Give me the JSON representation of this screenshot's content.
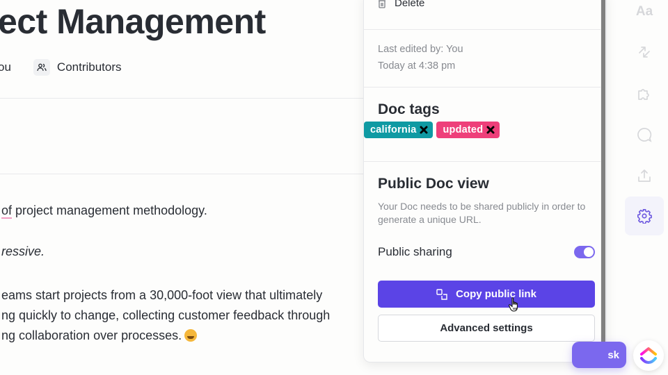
{
  "document": {
    "title": "ect Management",
    "meta": {
      "author_fragment": "ou",
      "contributors_label": "Contributors",
      "contributors_icon": "users-icon"
    },
    "paragraphs": {
      "p1_underlined": "of",
      "p1_rest": " project management methodology.",
      "p2": "ressive.",
      "p3_lines": [
        "eams start projects from a 30,000-foot view that ultimately",
        "ng quickly to change, collecting customer feedback through",
        "ng collaboration over processes."
      ],
      "p3_emoji": "star-struck-emoji"
    }
  },
  "panel": {
    "delete_label": "Delete",
    "delete_icon": "trash-icon",
    "last_edited_by": "Last edited by: You",
    "last_edited_time": "Today at 4:38 pm",
    "tags_title": "Doc tags",
    "tags": [
      {
        "label": "california",
        "color": "#0f9aa3"
      },
      {
        "label": "updated",
        "color": "#ee3f7a"
      }
    ],
    "public_title": "Public Doc view",
    "public_description": "Your Doc needs to be shared publicly in order to generate a unique URL.",
    "public_sharing_label": "Public sharing",
    "public_sharing_enabled": true,
    "copy_link_label": "Copy public link",
    "copy_link_icon": "copy-icon",
    "advanced_settings_label": "Advanced settings"
  },
  "rail": {
    "items": [
      {
        "name": "text-format",
        "label": "Aa"
      },
      {
        "name": "relationships",
        "icon": "arrows-icon"
      },
      {
        "name": "integrations",
        "icon": "puzzle-icon"
      },
      {
        "name": "comments",
        "icon": "comment-icon"
      },
      {
        "name": "share",
        "icon": "upload-icon"
      },
      {
        "name": "settings",
        "icon": "gear-icon",
        "active": true
      }
    ]
  },
  "floating": {
    "task_button_fragment": "sk",
    "logo": "clickup-logo"
  },
  "colors": {
    "accent": "#7b68ee",
    "primary_button": "#5b44e6",
    "toggle_on": "#7b68ee",
    "settings_icon": "#6e5ae0"
  }
}
